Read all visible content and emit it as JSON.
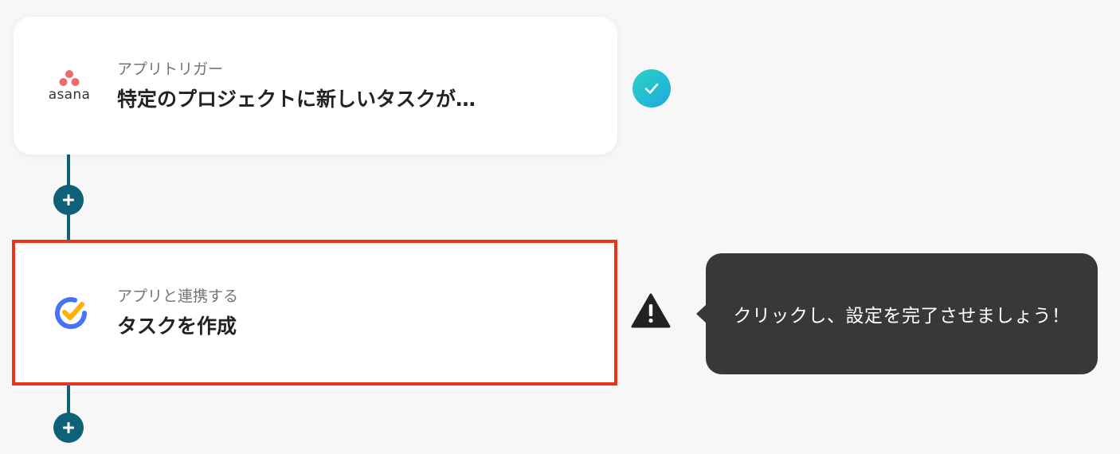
{
  "flow": {
    "trigger": {
      "label": "アプリトリガー",
      "title": "特定のプロジェクトに新しいタスクが…",
      "app_logo_text": "asana",
      "app_icon": "asana-logo-icon",
      "status_icon": "check-circle-icon"
    },
    "action": {
      "label": "アプリと連携する",
      "title": "タスクを作成",
      "app_icon": "ticktick-logo-icon",
      "status_icon": "warning-icon"
    },
    "add_step_icon": "plus-icon"
  },
  "tooltip": {
    "text": "クリックし、設定を完了させましょう！"
  },
  "colors": {
    "connector": "#0e6178",
    "highlight_border": "#e8341c",
    "check_gradient_start": "#2dd3c5",
    "check_gradient_end": "#1ba9e0",
    "tooltip_bg": "#383838",
    "asana_coral": "#f06a6a",
    "ticktick_blue": "#4772fa",
    "ticktick_yellow": "#ffb000"
  }
}
